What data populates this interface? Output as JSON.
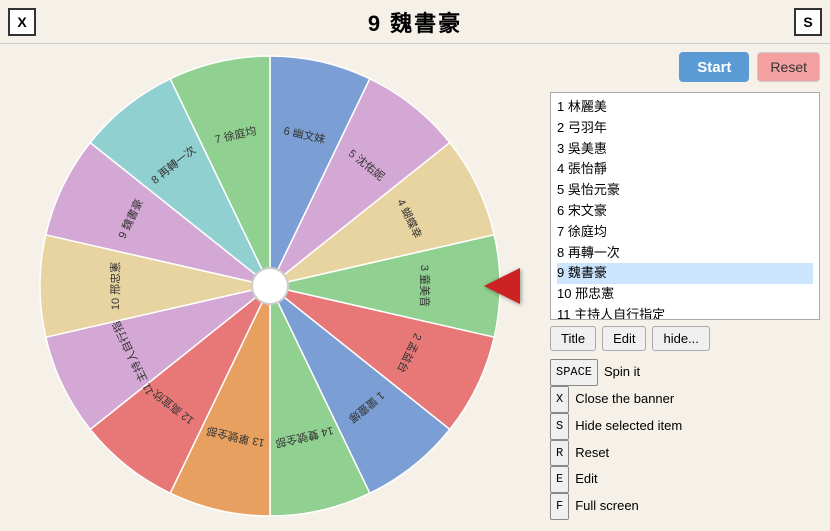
{
  "header": {
    "title": "9 魏書豪",
    "x_label": "X",
    "s_label": "S"
  },
  "buttons": {
    "start": "Start",
    "reset": "Reset"
  },
  "names": [
    "1 林麗美",
    "2 弓羽年",
    "3 吳美惠",
    "4 張怡靜",
    "5 吳怡元豪",
    "6 宋文豪",
    "7 徐庭均",
    "8 再轉一次",
    "9 魏書豪",
    "10 邢忠憲",
    "11 主持人自行指定",
    "12 高宜欣",
    "13 單號全部",
    "14 雙號全部"
  ],
  "list_buttons": {
    "title": "Title",
    "edit": "Edit",
    "hide": "hide..."
  },
  "shortcuts": [
    {
      "key": "SPACE",
      "label": "Spin it"
    },
    {
      "key": "X",
      "label": "Close the banner"
    },
    {
      "key": "S",
      "label": "Hide selected item"
    },
    {
      "key": "R",
      "label": "Reset"
    },
    {
      "key": "E",
      "label": "Edit"
    },
    {
      "key": "F",
      "label": "Full screen"
    }
  ],
  "wheel": {
    "segments": [
      {
        "label": "幽文妹",
        "num": "6",
        "color": "#7b9fd4"
      },
      {
        "label": "沈佑妮",
        "num": "5",
        "color": "#d4a8d4"
      },
      {
        "label": "蝴蝶幸",
        "num": "4",
        "color": "#e8d4a0"
      },
      {
        "label": "童美音",
        "num": "3",
        "color": "#90d090"
      },
      {
        "label": "孟益台",
        "num": "2",
        "color": "#e87878"
      },
      {
        "label": "蠻靈娜",
        "num": "1",
        "color": "#7b9fd4"
      },
      {
        "label": "雙號全部",
        "num": "14",
        "color": "#90d090"
      },
      {
        "label": "單號全部",
        "num": "13",
        "color": "#e8a060"
      },
      {
        "label": "高宜欣",
        "num": "12",
        "color": "#e87878"
      },
      {
        "label": "主持人自行指定",
        "num": "11",
        "color": "#d4a8d4"
      },
      {
        "label": "邢忠憲",
        "num": "10",
        "color": "#e8d4a0"
      },
      {
        "label": "魏書豪",
        "num": "9",
        "color": "#d4a8d4"
      },
      {
        "label": "再轉一次",
        "num": "8",
        "color": "#90d0d0"
      },
      {
        "label": "徐庭均",
        "num": "7",
        "color": "#90d090"
      }
    ]
  }
}
